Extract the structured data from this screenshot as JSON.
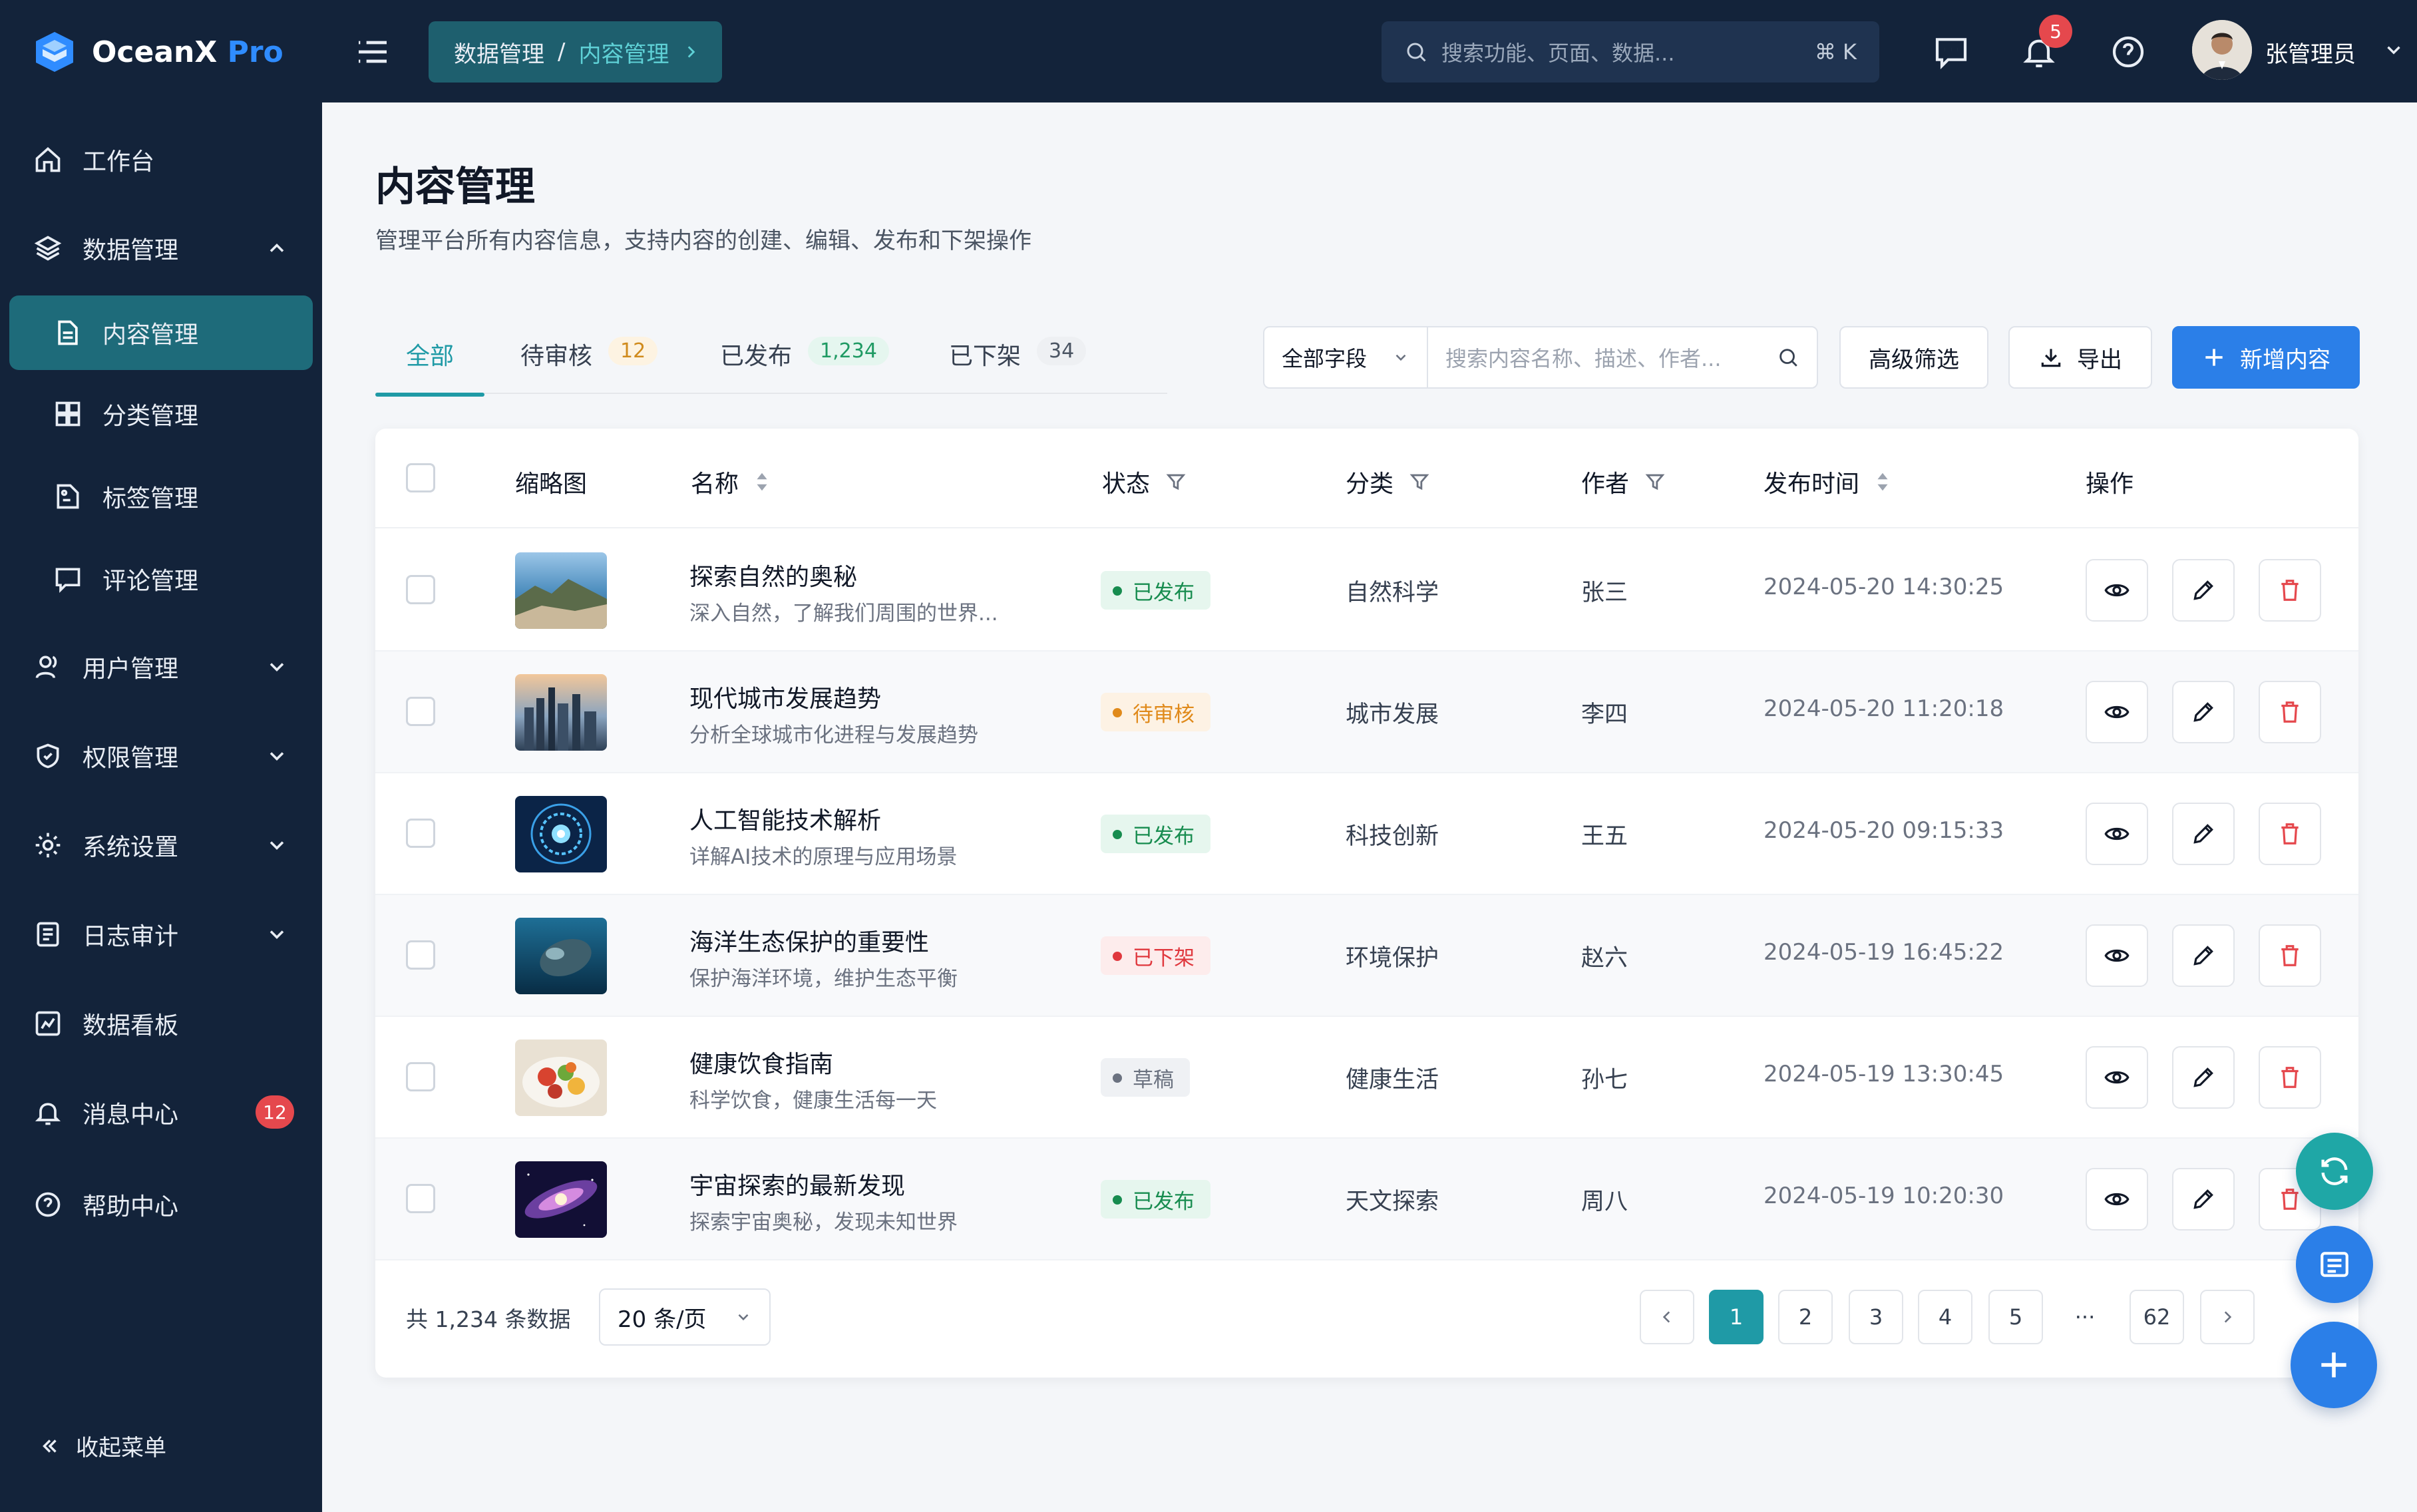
{
  "app": {
    "name": "OceanX",
    "edition": "Pro"
  },
  "sidebar": {
    "items": [
      {
        "label": "工作台",
        "icon": "home-icon"
      },
      {
        "label": "数据管理",
        "icon": "layers-icon"
      },
      {
        "label": "内容管理",
        "icon": "document-icon"
      },
      {
        "label": "分类管理",
        "icon": "category-icon"
      },
      {
        "label": "标签管理",
        "icon": "tag-icon"
      },
      {
        "label": "评论管理",
        "icon": "comment-icon"
      },
      {
        "label": "用户管理",
        "icon": "user-icon"
      },
      {
        "label": "权限管理",
        "icon": "shield-icon"
      },
      {
        "label": "系统设置",
        "icon": "gear-icon"
      },
      {
        "label": "日志审计",
        "icon": "log-icon"
      },
      {
        "label": "数据看板",
        "icon": "chart-icon"
      },
      {
        "label": "消息中心",
        "icon": "bell-icon",
        "badge": "12"
      },
      {
        "label": "帮助中心",
        "icon": "help-icon"
      }
    ],
    "collapse_label": "收起菜单"
  },
  "topbar": {
    "breadcrumb": {
      "parent": "数据管理",
      "separator": "/",
      "current": "内容管理"
    },
    "search_placeholder": "搜索功能、页面、数据...",
    "search_shortcut": "⌘ K",
    "notification_count": "5",
    "user_name": "张管理员"
  },
  "page": {
    "title": "内容管理",
    "description": "管理平台所有内容信息，支持内容的创建、编辑、发布和下架操作"
  },
  "tabs": [
    {
      "label": "全部",
      "count": ""
    },
    {
      "label": "待审核",
      "count": "12"
    },
    {
      "label": "已发布",
      "count": "1,234"
    },
    {
      "label": "已下架",
      "count": "34"
    }
  ],
  "filter": {
    "field_select": "全部字段",
    "search_placeholder": "搜索内容名称、描述、作者...",
    "advanced_label": "高级筛选",
    "export_label": "导出",
    "add_label": "新增内容"
  },
  "table": {
    "columns": {
      "thumb": "缩略图",
      "name": "名称",
      "status": "状态",
      "category": "分类",
      "author": "作者",
      "time": "发布时间",
      "actions": "操作"
    },
    "rows": [
      {
        "title": "探索自然的奥秘",
        "desc": "深入自然，了解我们周围的世界...",
        "status": "已发布",
        "status_type": "pub",
        "category": "自然科学",
        "author": "张三",
        "time": "2024-05-20 14:30:25"
      },
      {
        "title": "现代城市发展趋势",
        "desc": "分析全球城市化进程与发展趋势",
        "status": "待审核",
        "status_type": "pend",
        "category": "城市发展",
        "author": "李四",
        "time": "2024-05-20 11:20:18"
      },
      {
        "title": "人工智能技术解析",
        "desc": "详解AI技术的原理与应用场景",
        "status": "已发布",
        "status_type": "pub",
        "category": "科技创新",
        "author": "王五",
        "time": "2024-05-20 09:15:33"
      },
      {
        "title": "海洋生态保护的重要性",
        "desc": "保护海洋环境，维护生态平衡",
        "status": "已下架",
        "status_type": "off",
        "category": "环境保护",
        "author": "赵六",
        "time": "2024-05-19 16:45:22"
      },
      {
        "title": "健康饮食指南",
        "desc": "科学饮食，健康生活每一天",
        "status": "草稿",
        "status_type": "draft",
        "category": "健康生活",
        "author": "孙七",
        "time": "2024-05-19 13:30:45"
      },
      {
        "title": "宇宙探索的最新发现",
        "desc": "探索宇宙奥秘，发现未知世界",
        "status": "已发布",
        "status_type": "pub",
        "category": "天文探索",
        "author": "周八",
        "time": "2024-05-19 10:20:30"
      }
    ]
  },
  "pagination": {
    "total_text": "共 1,234 条数据",
    "page_size": "20 条/页",
    "pages": [
      "1",
      "2",
      "3",
      "4",
      "5",
      "···",
      "62"
    ],
    "current": "1"
  },
  "colors": {
    "sidebar": "#13233a",
    "accent": "#1f9aa6",
    "primary": "#2b7fe8",
    "danger": "#e5484d"
  }
}
